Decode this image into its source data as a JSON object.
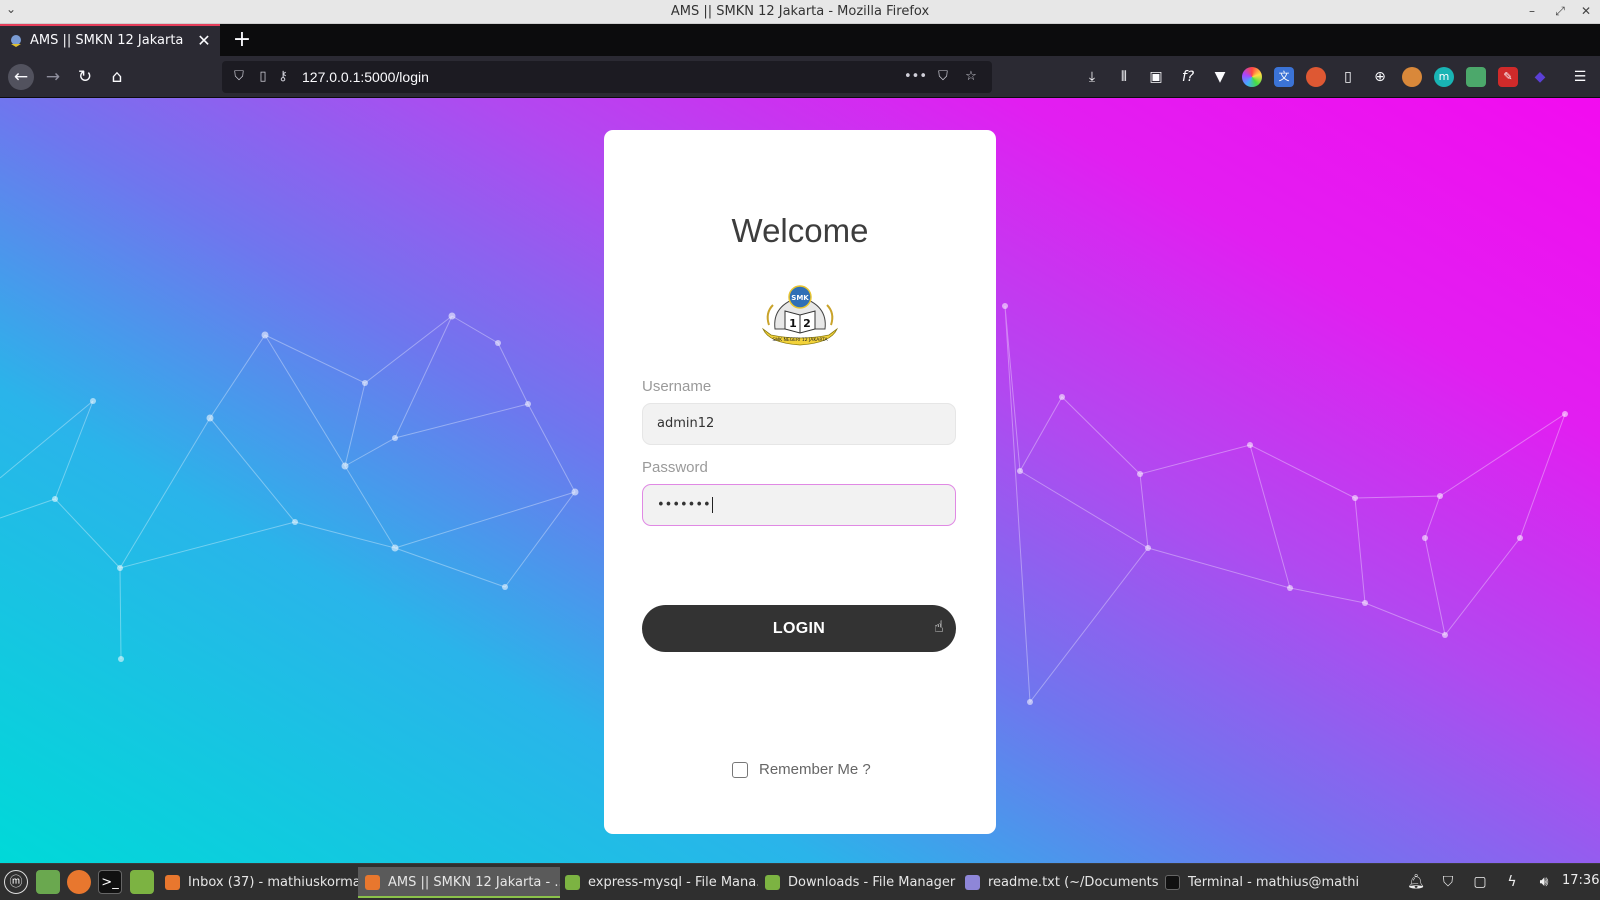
{
  "window": {
    "title": "AMS || SMKN 12 Jakarta - Mozilla Firefox"
  },
  "browser": {
    "tab_title": "AMS || SMKN 12 Jakarta",
    "url": "127.0.0.1:5000/login",
    "icons": {
      "back": "back-arrow-icon",
      "forward": "forward-arrow-icon",
      "reload": "reload-icon",
      "home": "home-icon",
      "toolbar": [
        "download-icon",
        "library-icon",
        "sidebar-icon",
        "fx-icon",
        "vue-devtools-icon",
        "color-picker-icon",
        "translate-icon",
        "duckduckgo-icon",
        "device-icon",
        "globe-icon",
        "cookie-icon",
        "m-extension-icon",
        "screenshot-icon",
        "pen-icon",
        "diamond-icon",
        "hamburger-menu-icon"
      ]
    }
  },
  "login": {
    "heading": "Welcome",
    "logo_text_top": "SMK",
    "logo_text_mid_left": "1",
    "logo_text_mid_right": "2",
    "logo_banner": "SMK NEGERI 12 JAKARTA",
    "username_label": "Username",
    "username_value": "admin12",
    "password_label": "Password",
    "password_value": "•••••••",
    "login_button": "LOGIN",
    "remember_label": "Remember Me ?",
    "remember_checked": false
  },
  "colors": {
    "bg_gradient_start": "#00d9d8",
    "bg_gradient_end": "#f30bf0",
    "button": "#333333",
    "focus_border": "#e089e4"
  },
  "taskbar": {
    "items": [
      "Inbox (37) - mathiuskorma...",
      "AMS || SMKN 12 Jakarta - ...",
      "express-mysql - File Mana...",
      "Downloads - File Manager",
      "readme.txt (~/Documents...",
      "Terminal - mathius@mathi..."
    ],
    "clock": "17:36"
  }
}
